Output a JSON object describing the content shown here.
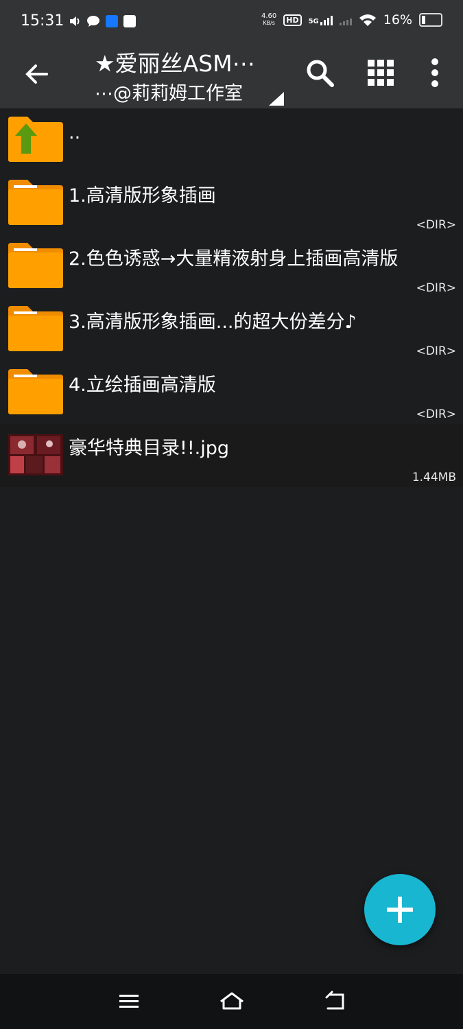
{
  "status_bar": {
    "time": "15:31",
    "speed_value": "4.60",
    "speed_unit": "KB/s",
    "hd_label": "HD",
    "network_label": "5G",
    "battery_text": "16%"
  },
  "app_bar": {
    "title_line1": "★爱丽丝ASM⋯",
    "title_line2": "⋯@莉莉姆工作室"
  },
  "files": [
    {
      "name": "..",
      "meta": "",
      "type": "parent"
    },
    {
      "name": "1.高清版形象插画",
      "meta": "<DIR>",
      "type": "dir"
    },
    {
      "name": "2.色色诱惑→大量精液射身上插画高清版",
      "meta": "<DIR>",
      "type": "dir"
    },
    {
      "name": "3.高清版形象插画...的超大份差分♪",
      "meta": "<DIR>",
      "type": "dir"
    },
    {
      "name": "4.立绘插画高清版",
      "meta": "<DIR>",
      "type": "dir"
    },
    {
      "name": "豪华特典目录!!.jpg",
      "meta": "1.44MB",
      "type": "image"
    }
  ],
  "colors": {
    "bar_bg": "#333436",
    "list_bg": "#1c1d1f",
    "folder": "#ff9f00",
    "fab": "#19b6d1"
  }
}
